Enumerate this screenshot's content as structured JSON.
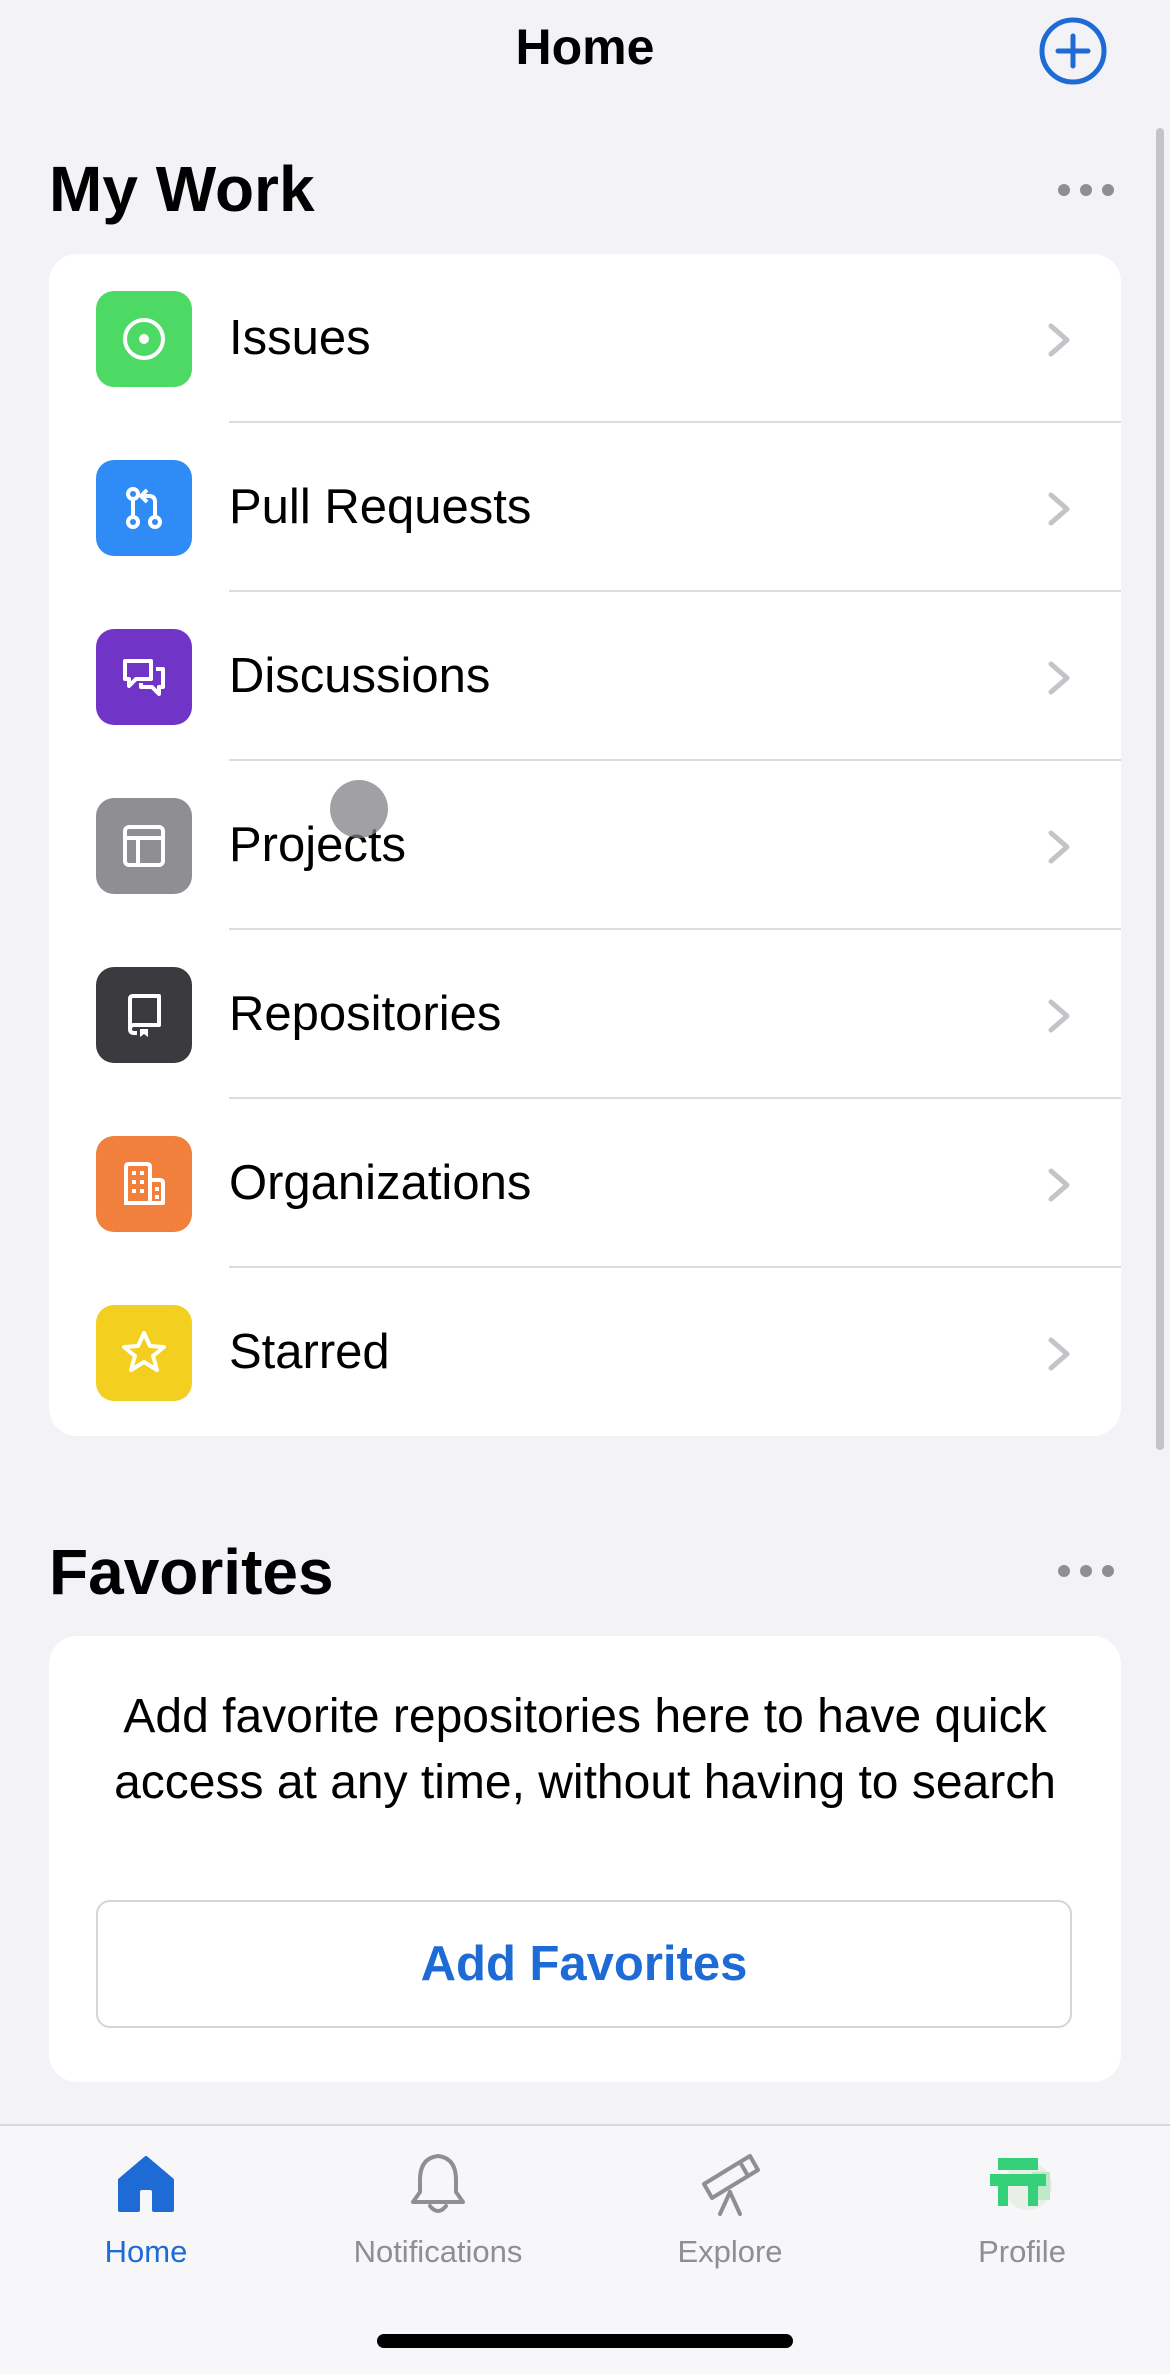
{
  "header": {
    "title": "Home"
  },
  "my_work": {
    "title": "My Work",
    "items": [
      {
        "label": "Issues",
        "icon": "issue-open-icon",
        "color": "#4cd964"
      },
      {
        "label": "Pull Requests",
        "icon": "pull-request-icon",
        "color": "#2f8bf5"
      },
      {
        "label": "Discussions",
        "icon": "discussion-icon",
        "color": "#7034c6"
      },
      {
        "label": "Projects",
        "icon": "project-table-icon",
        "color": "#8e8e93"
      },
      {
        "label": "Repositories",
        "icon": "repo-icon",
        "color": "#3a3a3f"
      },
      {
        "label": "Organizations",
        "icon": "organization-icon",
        "color": "#f0803c"
      },
      {
        "label": "Starred",
        "icon": "star-icon",
        "color": "#f3cf1f"
      }
    ]
  },
  "favorites": {
    "title": "Favorites",
    "description": "Add favorite repositories here to have quick access at any time, without having to search",
    "button_label": "Add Favorites"
  },
  "tabs": [
    {
      "label": "Home",
      "icon": "home-icon",
      "active": true
    },
    {
      "label": "Notifications",
      "icon": "bell-icon",
      "active": false
    },
    {
      "label": "Explore",
      "icon": "telescope-icon",
      "active": false
    },
    {
      "label": "Profile",
      "icon": "avatar",
      "active": false
    }
  ],
  "colors": {
    "accent": "#1e6bd6",
    "background": "#f2f2f7",
    "inactive": "#8e8e93"
  }
}
